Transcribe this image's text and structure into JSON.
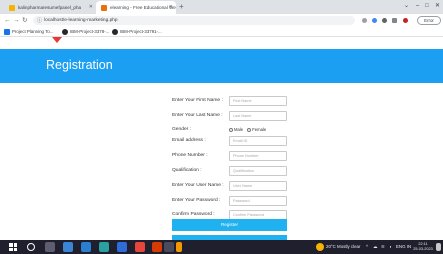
{
  "browser": {
    "tabs": [
      {
        "label": "kalinpharmaresumefpanel_pha"
      },
      {
        "label": "elearning - Free Educational We"
      }
    ],
    "url": "localhost/e-learning-marketing.php",
    "profile_label": "Error",
    "bookmarks": [
      {
        "label": "Project Planning To..."
      },
      {
        "label": "IBM-Project-3378-..."
      },
      {
        "label": "IBM-Project-33791-..."
      }
    ]
  },
  "page": {
    "title": "Registration",
    "fields": [
      {
        "label": "Enter Your First Name :",
        "placeholder": "First Name"
      },
      {
        "label": "Enter Your Last Name :",
        "placeholder": "Last Name"
      },
      {
        "label": "Email address :",
        "placeholder": "Email ID"
      },
      {
        "label": "Phone Number :",
        "placeholder": "Phone Number"
      },
      {
        "label": "Qualification :",
        "placeholder": "Qualification"
      },
      {
        "label": "Enter Your User Name :",
        "placeholder": "User Name"
      },
      {
        "label": "Enter Your Password :",
        "placeholder": "Password"
      },
      {
        "label": "Confirm Password :",
        "placeholder": "Confirm Password"
      }
    ],
    "gender": {
      "label": "Gender :",
      "options": [
        "Male",
        "Female"
      ]
    },
    "register_label": "Register"
  },
  "taskbar": {
    "weather": "20°C Mostly clear",
    "language": "ENG IN",
    "time": "22:11",
    "date": "25-03-2023"
  },
  "colors": {
    "banner": "#1a9ff2",
    "button": "#1fb1f0",
    "taskbar": "#1f1f2e",
    "arrow": "#e53935"
  }
}
